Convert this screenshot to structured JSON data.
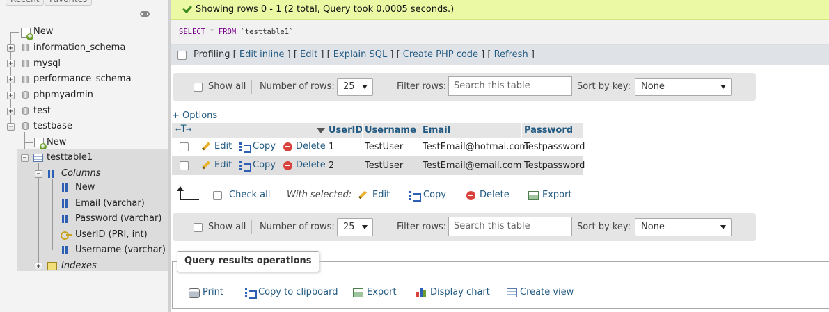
{
  "sidebar": {
    "tabs": [
      "Recent",
      "Favorites"
    ],
    "databases": [
      {
        "label": "New"
      },
      {
        "label": "information_schema"
      },
      {
        "label": "mysql"
      },
      {
        "label": "performance_schema"
      },
      {
        "label": "phpmyadmin"
      },
      {
        "label": "test"
      },
      {
        "label": "testbase"
      }
    ],
    "testbase_children": {
      "new_label": "New",
      "table_label": "testtable1",
      "columns_label": "Columns",
      "columns": [
        {
          "label": "New"
        },
        {
          "label": "Email (varchar)"
        },
        {
          "label": "Password (varchar)"
        },
        {
          "label": "UserID (PRI, int)"
        },
        {
          "label": "Username (varchar)"
        }
      ],
      "indexes_label": "Indexes"
    }
  },
  "main": {
    "success_message": "Showing rows 0 - 1 (2 total, Query took 0.0005 seconds.)",
    "sql": {
      "select": "SELECT",
      "star": " * ",
      "from": "FROM",
      "table": " `testtable1`"
    },
    "profiling": {
      "label": "Profiling",
      "links": [
        "Edit inline",
        "Edit",
        "Explain SQL",
        "Create PHP code",
        "Refresh"
      ]
    },
    "navbar": {
      "show_all": "Show all",
      "number_of_rows_label": "Number of rows:",
      "number_of_rows_value": "25",
      "filter_rows_label": "Filter rows:",
      "search_placeholder": "Search this table",
      "sort_by_key_label": "Sort by key:",
      "sort_by_key_value": "None"
    },
    "options_link": "+ Options",
    "table": {
      "sort_arrows": "←T→",
      "columns": [
        "UserID",
        "Username",
        "Email",
        "Password"
      ],
      "row_actions": {
        "edit": "Edit",
        "copy": "Copy",
        "delete": "Delete"
      },
      "rows": [
        {
          "UserID": "1",
          "Username": "TestUser",
          "Email": "TestEmail@hotmai.com",
          "Password": "Testpassword"
        },
        {
          "UserID": "2",
          "Username": "TestUser",
          "Email": "TestEmail@email.com",
          "Password": "Testpassword"
        }
      ]
    },
    "bulk": {
      "check_all": "Check all",
      "with_selected": "With selected:",
      "edit": "Edit",
      "copy": "Copy",
      "delete": "Delete",
      "export": "Export"
    },
    "query_results_operations": {
      "title": "Query results operations",
      "items": [
        "Print",
        "Copy to clipboard",
        "Export",
        "Display chart",
        "Create view"
      ]
    }
  },
  "colors": {
    "link": "#235a81",
    "success_bg": "#ebf8a4",
    "delete_red": "#d9423c",
    "row_alt": "#dfdfdf"
  }
}
